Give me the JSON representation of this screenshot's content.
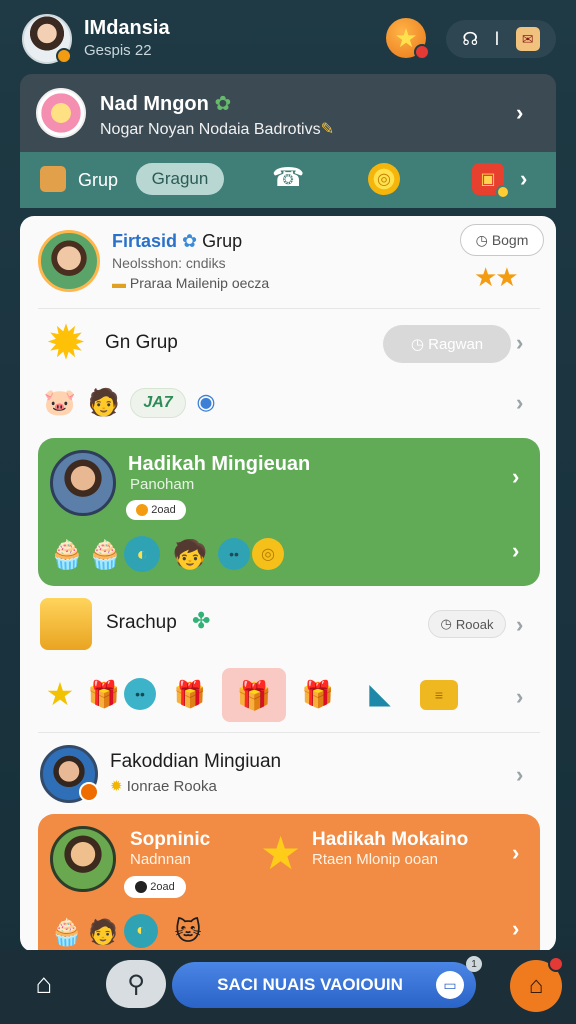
{
  "header": {
    "user_name": "IMdansia",
    "user_sub": "Gespis 22"
  },
  "promo": {
    "title": "Nad Mngon",
    "subtitle": "Nogar Noyan Nodaia Badrotivs"
  },
  "tabs": {
    "grup": "Grup",
    "gragun": "Gragun"
  },
  "row1": {
    "title_blue": "Firtasid",
    "title_rest": "Grup",
    "sub1": "Neolsshon: cndiks",
    "sub2": "Praraa Mailenip oecza",
    "button": "Bogm"
  },
  "row2": {
    "title": "Gn Grup",
    "button": "Ragwan"
  },
  "row3": {
    "badge": "JA7"
  },
  "green_card": {
    "title": "Hadikah Mingieuan",
    "subtitle": "Panoham",
    "pill": "2oad"
  },
  "row5": {
    "title": "Srachup",
    "button": "Rooak"
  },
  "row7": {
    "title": "Fakoddian Mingiuan",
    "subtitle": "Ionrae Rooka"
  },
  "orange_card": {
    "title_left": "Sopninic",
    "sub_left": "Nadnnan",
    "pill": "2oad",
    "title_right": "Hadikah Mokaino",
    "sub_right": "Rtaen Mlonip ooan"
  },
  "bottom": {
    "cta": "SACI NUAIS VAOIOUIN",
    "cta_badge": "1"
  },
  "icons": {
    "top_star": "star-icon",
    "home": "home-icon",
    "search": "search-icon",
    "shop": "shop-icon"
  },
  "colors": {
    "green_card": "#62ab56",
    "orange_card": "#f28b43",
    "teal_tabs": "#3f7f77",
    "cta_blue": "#2b63c7"
  }
}
